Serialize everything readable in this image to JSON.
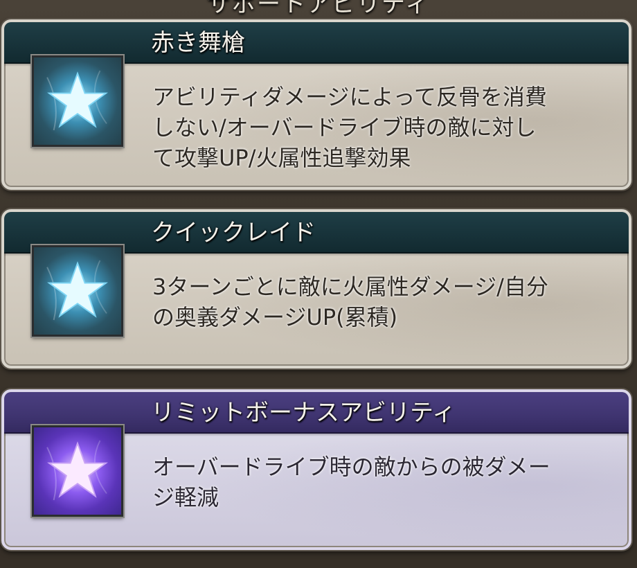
{
  "section_title": "サポートアビリティ",
  "abilities": [
    {
      "name": "赤き舞槍",
      "description": "アビリティダメージによって反骨を消費\nしない/オーバードライブ時の敵に対し\nて攻撃UP/火属性追撃効果",
      "icon": "star-icon",
      "kind": "support"
    },
    {
      "name": "クイックレイド",
      "description": "3ターンごとに敵に火属性ダメージ/自分\nの奥義ダメージUP(累積)",
      "icon": "star-icon",
      "kind": "support"
    },
    {
      "name": "リミットボーナスアビリティ",
      "description": "オーバードライブ時の敵からの被ダメー\nジ軽減",
      "icon": "star-icon",
      "kind": "limit-bonus"
    }
  ],
  "colors": {
    "support_header": "#173239",
    "limit_header": "#3f3470",
    "support_icon_glow": "#9fe7ff",
    "limit_icon_glow": "#f0d8ff"
  }
}
